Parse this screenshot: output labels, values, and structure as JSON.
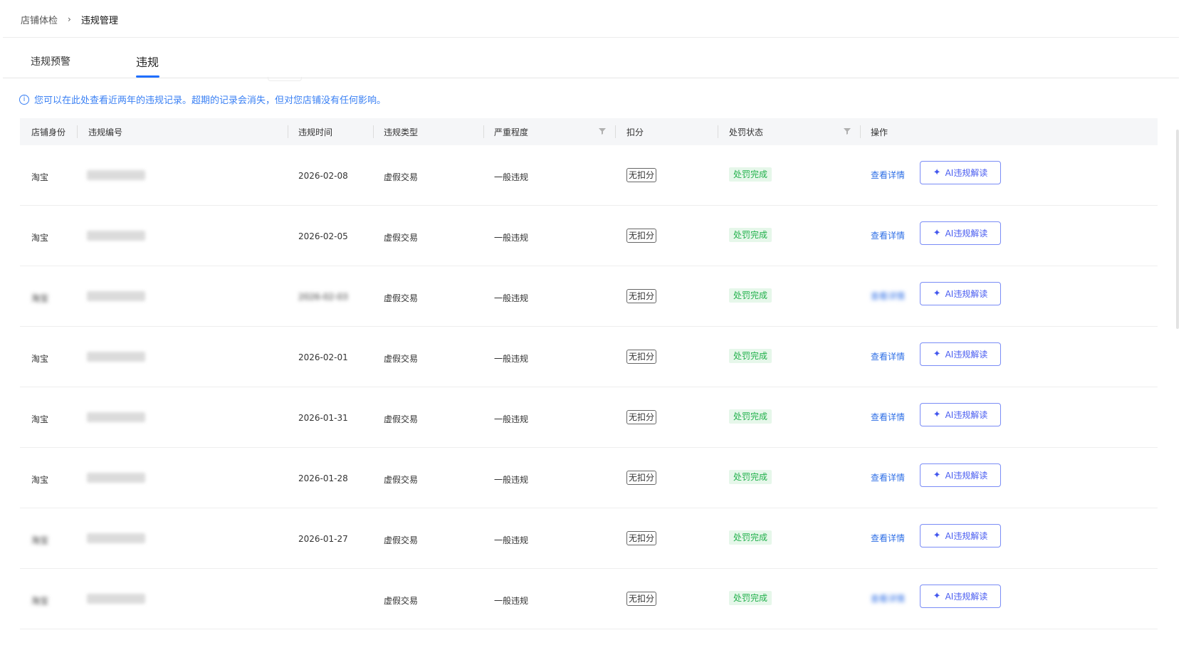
{
  "breadcrumb": {
    "parent": "店铺体检",
    "separator": "›",
    "current": "违规管理"
  },
  "tabs": [
    {
      "label": "违规预警"
    },
    {
      "label": "违规"
    }
  ],
  "notice": {
    "icon": "info-icon",
    "text": "您可以在此处查看近两年的违规记录。超期的记录会消失，但对您店铺没有任何影响。"
  },
  "table": {
    "headers": [
      "店铺身份",
      "违规编号",
      "违规时间",
      "违规类型",
      "严重程度",
      "扣分",
      "处罚状态",
      "操作"
    ],
    "rows": [
      {
        "shop": "淘宝",
        "id": "",
        "time": "2026-02-08",
        "type": "虚假交易",
        "severity": "一般违规",
        "points": "无扣分",
        "status": "处罚完成",
        "detail": "查看详情",
        "ai": "AI违规解读"
      },
      {
        "shop": "淘宝",
        "id": "",
        "time": "2026-02-05",
        "type": "虚假交易",
        "severity": "一般违规",
        "points": "无扣分",
        "status": "处罚完成",
        "detail": "查看详情",
        "ai": "AI违规解读"
      },
      {
        "shop": "淘宝",
        "id": "",
        "time": "2026-02-03",
        "type": "虚假交易",
        "severity": "一般违规",
        "points": "无扣分",
        "status": "处罚完成",
        "detail": "查看详情",
        "ai": "AI违规解读"
      },
      {
        "shop": "淘宝",
        "id": "",
        "time": "2026-02-01",
        "type": "虚假交易",
        "severity": "一般违规",
        "points": "无扣分",
        "status": "处罚完成",
        "detail": "查看详情",
        "ai": "AI违规解读"
      },
      {
        "shop": "淘宝",
        "id": "",
        "time": "2026-01-31",
        "type": "虚假交易",
        "severity": "一般违规",
        "points": "无扣分",
        "status": "处罚完成",
        "detail": "查看详情",
        "ai": "AI违规解读"
      },
      {
        "shop": "淘宝",
        "id": "",
        "time": "2026-01-28",
        "type": "虚假交易",
        "severity": "一般违规",
        "points": "无扣分",
        "status": "处罚完成",
        "detail": "查看详情",
        "ai": "AI违规解读"
      },
      {
        "shop": "淘宝",
        "id": "",
        "time": "2026-01-27",
        "type": "虚假交易",
        "severity": "一般违规",
        "points": "无扣分",
        "status": "处罚完成",
        "detail": "查看详情",
        "ai": "AI违规解读"
      },
      {
        "shop": "淘宝",
        "id": "",
        "time": "",
        "type": "虚假交易",
        "severity": "一般违规",
        "points": "无扣分",
        "status": "处罚完成",
        "detail": "查看详情",
        "ai": "AI违规解读"
      }
    ]
  },
  "colors": {
    "accent": "#1f6fff",
    "link": "#2f6fe6",
    "success_bg": "#e6f7ea",
    "success_text": "#22b14c",
    "ai_border": "#7a8cf6"
  }
}
